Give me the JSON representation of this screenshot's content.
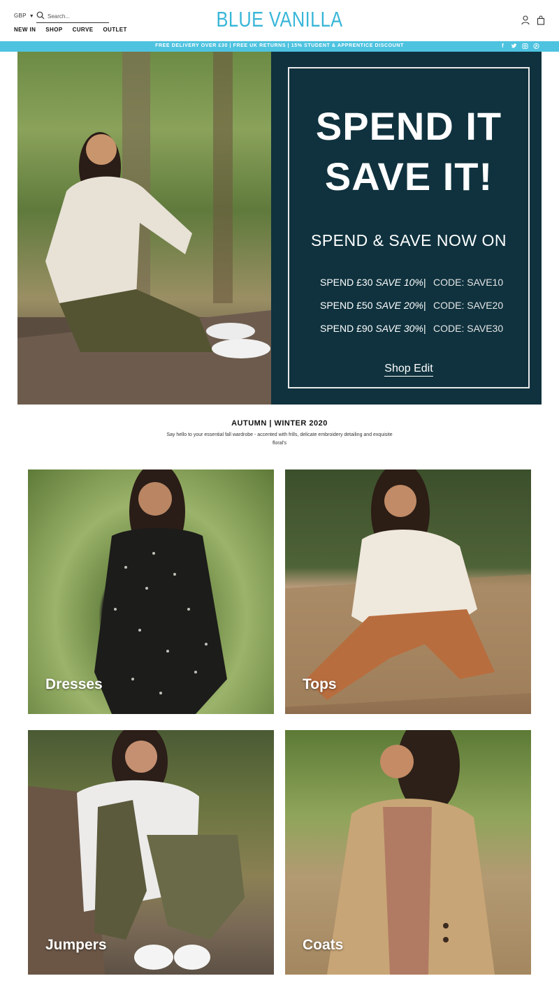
{
  "header": {
    "currency": "GBP",
    "search_placeholder": "Search...",
    "logo": "BLUE VANILLA",
    "nav": [
      "NEW IN",
      "SHOP",
      "CURVE",
      "OUTLET"
    ]
  },
  "promo_bar": {
    "text": "FREE DELIVERY OVER £30 | FREE UK RETURNS | 15% STUDENT & APPRENTICE DISCOUNT",
    "social": [
      "facebook-icon",
      "twitter-icon",
      "instagram-icon",
      "pinterest-icon"
    ],
    "color": "#4ec3e0"
  },
  "hero": {
    "title_line1": "SPEND IT",
    "title_line2": "SAVE IT!",
    "subtitle": "SPEND & SAVE NOW ON",
    "offers": [
      {
        "spend": "SPEND £30 ",
        "save": "SAVE 10%",
        "code": "CODE: SAVE10"
      },
      {
        "spend": "SPEND £50 ",
        "save": "SAVE 20%",
        "code": "CODE: SAVE20"
      },
      {
        "spend": "SPEND £90 ",
        "save": "SAVE 30%",
        "code": "CODE: SAVE30"
      }
    ],
    "separator": "|",
    "cta": "Shop Edit",
    "panel_color": "#0f323e"
  },
  "intro": {
    "title": "AUTUMN | WINTER 2020",
    "text": "Say hello to your essential fall wardrobe  - accented with frills, delicate embroidery detailing and exquisite floral's"
  },
  "categories": [
    "Dresses",
    "Tops",
    "Jumpers",
    "Coats"
  ],
  "colors": {
    "brand": "#38b6d8"
  }
}
